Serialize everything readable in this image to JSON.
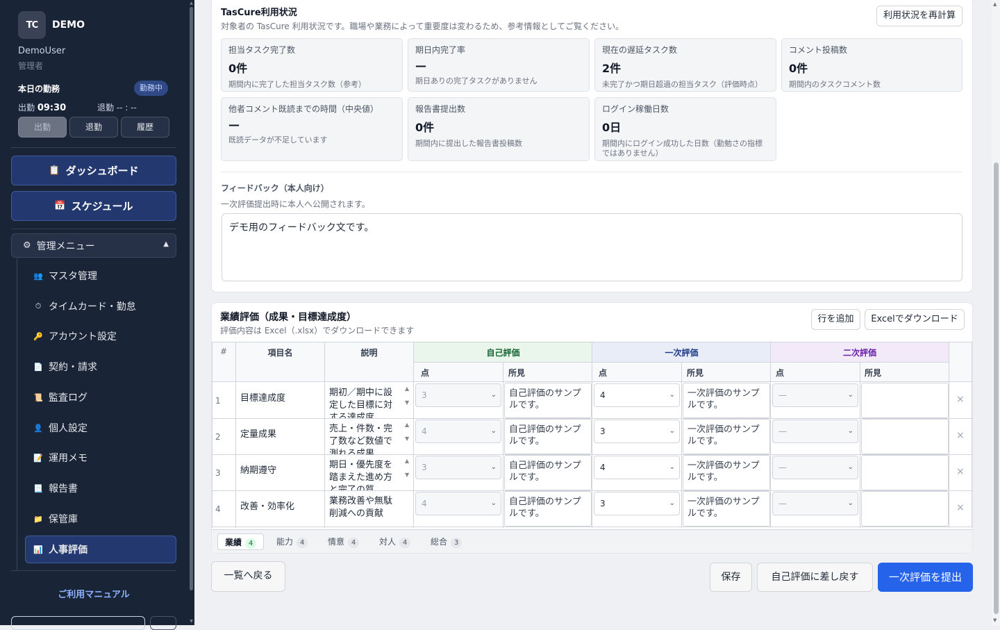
{
  "sidebar": {
    "logo": "TC",
    "brand": "DEMO",
    "user_name": "DemoUser",
    "user_role": "管理者",
    "attendance": {
      "title": "本日の勤務",
      "badge": "勤務中",
      "in_label": "出勤",
      "in_time": "09:30",
      "out_label": "退勤",
      "out_time": "-- : --",
      "btn_in": "出勤",
      "btn_out": "退勤",
      "btn_history": "履歴"
    },
    "dashboard": "ダッシュボード",
    "schedule": "スケジュール",
    "admin_menu": "管理メニュー",
    "items": [
      {
        "label": "マスタ管理",
        "icon": "users-icon"
      },
      {
        "label": "タイムカード・勤怠",
        "icon": "clock-icon"
      },
      {
        "label": "アカウント設定",
        "icon": "key-icon"
      },
      {
        "label": "契約・請求",
        "icon": "document-icon"
      },
      {
        "label": "監査ログ",
        "icon": "log-icon"
      },
      {
        "label": "個人設定",
        "icon": "person-icon"
      },
      {
        "label": "運用メモ",
        "icon": "memo-icon"
      },
      {
        "label": "報告書",
        "icon": "report-icon"
      },
      {
        "label": "保管庫",
        "icon": "folder-icon"
      },
      {
        "label": "人事評価",
        "icon": "chart-icon"
      }
    ],
    "manual": "ご利用マニュアル"
  },
  "usage": {
    "title": "TasCure利用状況",
    "subtitle": "対象者の TasCure 利用状況です。職場や業務によって重要度は変わるため、参考情報としてご覧ください。",
    "recalc": "利用状況を再計算",
    "stats": [
      {
        "label": "担当タスク完了数",
        "value": "0件",
        "note": "期間内に完了した担当タスク数（参考）"
      },
      {
        "label": "期日内完了率",
        "value": "—",
        "note": "期日ありの完了タスクがありません"
      },
      {
        "label": "現在の遅延タスク数",
        "value": "2件",
        "note": "未完了かつ期日超過の担当タスク（評価時点）"
      },
      {
        "label": "コメント投稿数",
        "value": "0件",
        "note": "期間内のタスクコメント数"
      },
      {
        "label": "他者コメント既読までの時間（中央値）",
        "value": "—",
        "note": "既読データが不足しています"
      },
      {
        "label": "報告書提出数",
        "value": "0件",
        "note": "期間内に提出した報告書投稿数"
      },
      {
        "label": "ログイン稼働日数",
        "value": "0日",
        "note": "期間内にログイン成功した日数（勤勉さの指標ではありません）"
      }
    ],
    "feedback_label": "フィードバック（本人向け）",
    "feedback_sub": "一次評価提出時に本人へ公開されます。",
    "feedback_text": "デモ用のフィードバック文です。"
  },
  "perf": {
    "title": "業績評価（成果・目標達成度）",
    "subtitle": "評価内容は Excel（.xlsx）でダウンロードできます",
    "add_row": "行を追加",
    "download": "Excelでダウンロード",
    "headers": {
      "no": "#",
      "item": "項目名",
      "desc": "説明",
      "self": "自己評価",
      "first": "一次評価",
      "second": "二次評価",
      "score": "点",
      "comment": "所見"
    },
    "colors": {
      "self_bg": "#eaf6ec",
      "first_bg": "#e8edf8",
      "second_bg": "#f2eaf8"
    },
    "rows": [
      {
        "no": "1",
        "item": "目標達成度",
        "desc": "期初／期中に設定した目標に対する達成度",
        "self_score": "3",
        "self_comment": "自己評価のサンプルです。",
        "first_score": "4",
        "first_comment": "一次評価のサンプルです。",
        "second_score": "—",
        "second_comment": ""
      },
      {
        "no": "2",
        "item": "定量成果",
        "desc": "売上・件数・完了数など数値で測れる成果",
        "self_score": "4",
        "self_comment": "自己評価のサンプルです。",
        "first_score": "3",
        "first_comment": "一次評価のサンプルです。",
        "second_score": "—",
        "second_comment": ""
      },
      {
        "no": "3",
        "item": "納期遵守",
        "desc": "期日・優先度を踏まえた進め方と完了の質",
        "self_score": "3",
        "self_comment": "自己評価のサンプルです。",
        "first_score": "4",
        "first_comment": "一次評価のサンプルです。",
        "second_score": "—",
        "second_comment": ""
      },
      {
        "no": "4",
        "item": "改善・効率化",
        "desc": "業務改善や無駄削減への貢献",
        "self_score": "4",
        "self_comment": "自己評価のサンプルです。",
        "first_score": "3",
        "first_comment": "一次評価のサンプルです。",
        "second_score": "—",
        "second_comment": ""
      }
    ],
    "tabs": [
      {
        "label": "業績",
        "count": "4"
      },
      {
        "label": "能力",
        "count": "4"
      },
      {
        "label": "情意",
        "count": "4"
      },
      {
        "label": "対人",
        "count": "4"
      },
      {
        "label": "総合",
        "count": "3"
      }
    ]
  },
  "footer": {
    "back": "一覧へ戻る",
    "save": "保存",
    "return": "自己評価に差し戻す",
    "submit": "一次評価を提出"
  }
}
